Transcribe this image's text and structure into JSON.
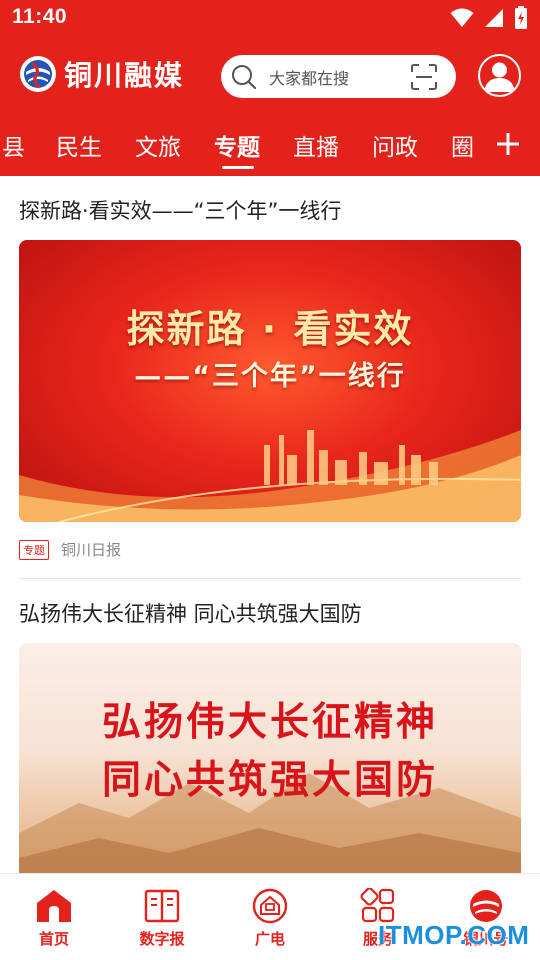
{
  "status_bar": {
    "time": "11:40"
  },
  "app": {
    "name": "铜川融媒"
  },
  "search": {
    "placeholder": "大家都在搜"
  },
  "tabs": [
    {
      "label": "县",
      "active": false
    },
    {
      "label": "民生",
      "active": false
    },
    {
      "label": "文旅",
      "active": false
    },
    {
      "label": "专题",
      "active": true
    },
    {
      "label": "直播",
      "active": false
    },
    {
      "label": "问政",
      "active": false
    },
    {
      "label": "圈",
      "active": false
    }
  ],
  "feed": [
    {
      "title": "探新路·看实效——“三个年”一线行",
      "banner_line1": "探新路 · 看实效",
      "banner_line2": "——“三个年”一线行",
      "tag": "专题",
      "source": "铜川日报"
    },
    {
      "title": "弘扬伟大长征精神 同心共筑强大国防",
      "banner_line1": "弘扬伟大长征精神",
      "banner_line2": "同心共筑强大国防"
    }
  ],
  "bottom_nav": [
    {
      "label": "首页",
      "icon": "home-icon",
      "active": true
    },
    {
      "label": "数字报",
      "icon": "book-icon",
      "active": false
    },
    {
      "label": "广电",
      "icon": "tv-icon",
      "active": false
    },
    {
      "label": "服务",
      "icon": "grid-icon",
      "active": false
    },
    {
      "label": "铜川号",
      "icon": "tongchuan-logo-icon",
      "active": false
    }
  ],
  "watermark": "ITMOP.COM",
  "colors": {
    "brand_red": "#e3221b",
    "banner_gold": "#ffe9a8",
    "watermark_blue": "#1a8fe0"
  }
}
